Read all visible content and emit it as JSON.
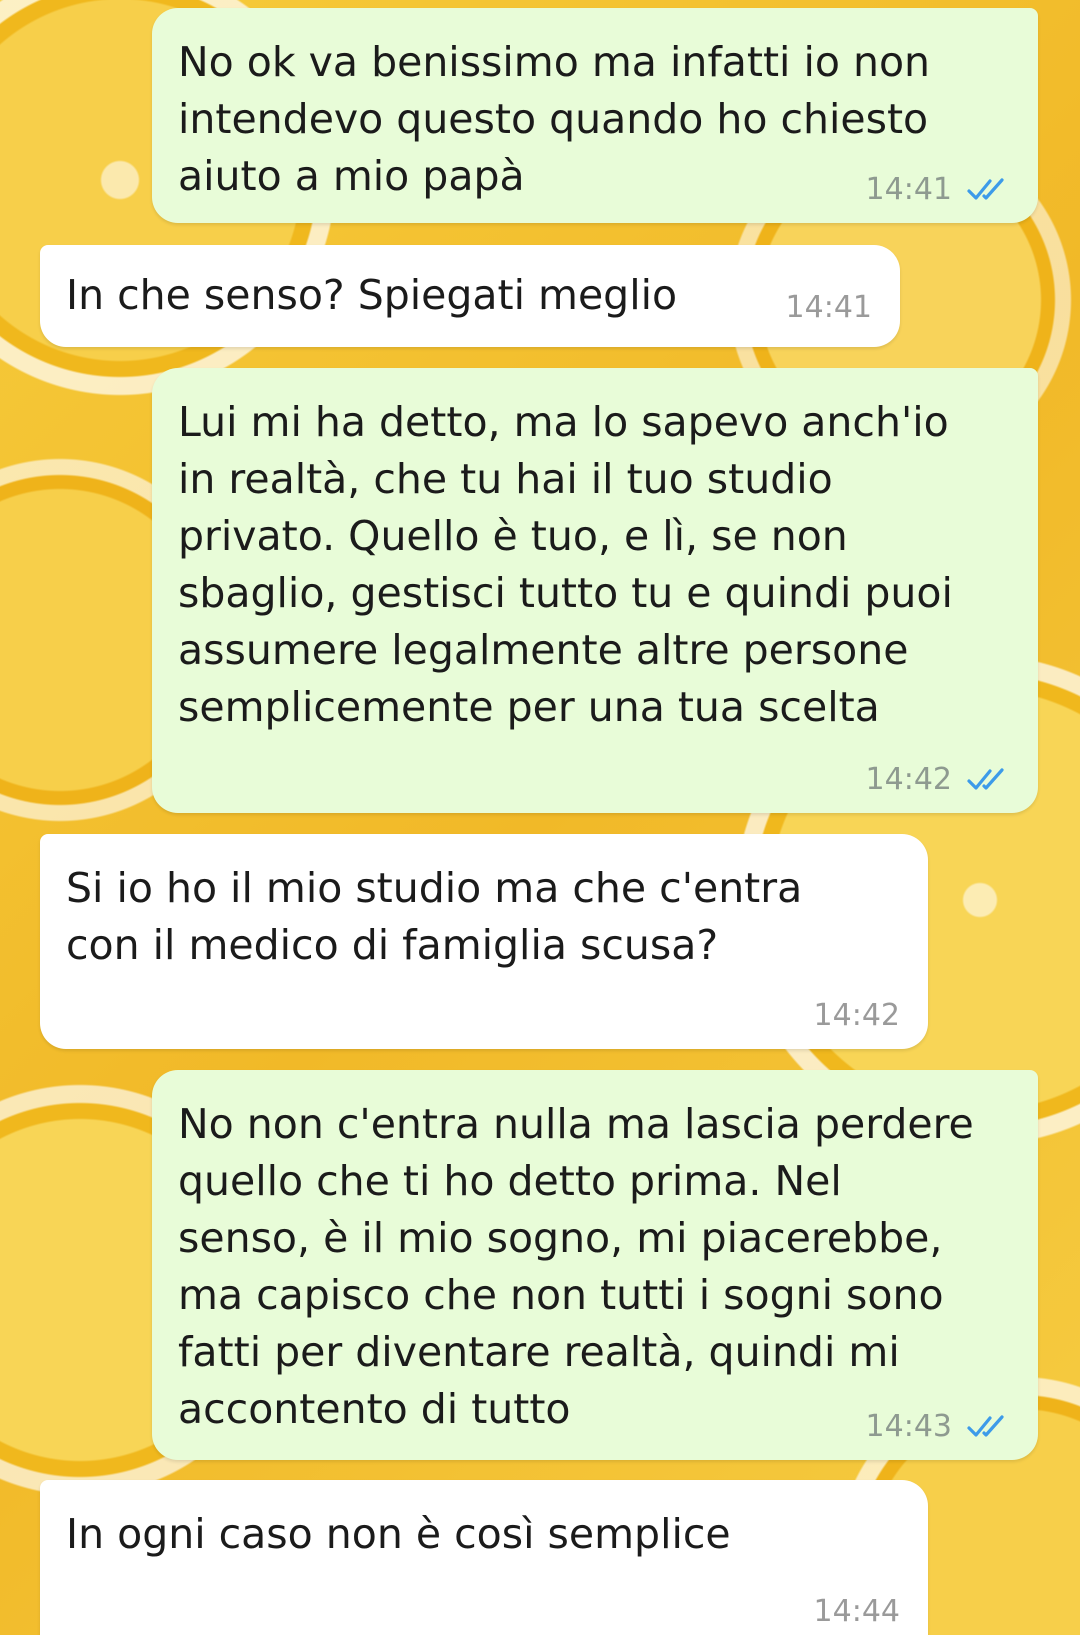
{
  "messages": [
    {
      "direction": "outgoing",
      "text": "No ok va benissimo ma infatti io non\nintendevo questo quando ho chiesto\naiuto a mio papà",
      "time": "14:41",
      "status_icon": "double-check-read-icon"
    },
    {
      "direction": "incoming",
      "text": "In che senso? Spiegati meglio",
      "time": "14:41"
    },
    {
      "direction": "outgoing",
      "text": "Lui mi ha detto, ma lo sapevo anch'io\nin realtà, che tu hai il tuo studio\nprivato. Quello è tuo, e lì, se non\nsbaglio, gestisci tutto tu e quindi puoi\nassumere legalmente altre persone\nsemplicemente per una tua scelta",
      "time": "14:42",
      "status_icon": "double-check-read-icon"
    },
    {
      "direction": "incoming",
      "text": "Si io ho il mio studio ma che c'entra\ncon il medico di famiglia scusa?",
      "time": "14:42"
    },
    {
      "direction": "outgoing",
      "text": "No non c'entra nulla ma lascia perdere\nquello che ti ho detto prima. Nel\nsenso, è il mio sogno, mi piacerebbe,\nma capisco che non tutti i sogni sono\nfatti per diventare realtà, quindi mi\naccontento di tutto",
      "time": "14:43",
      "status_icon": "double-check-read-icon"
    },
    {
      "direction": "incoming",
      "text": "In ogni caso non è così semplice",
      "time": "14:44"
    }
  ],
  "colors": {
    "outgoing_bubble": "#e8fcd8",
    "incoming_bubble": "#ffffff",
    "read_ticks": "#3d9be9",
    "background": "#f4c430"
  }
}
